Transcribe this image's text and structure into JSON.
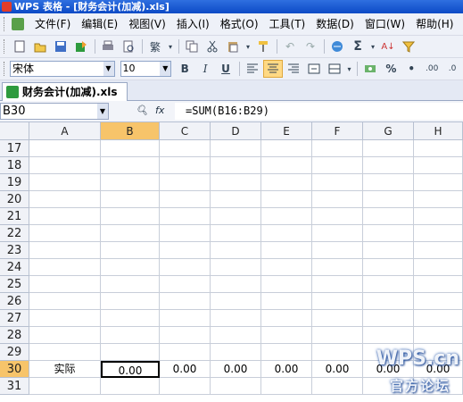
{
  "window": {
    "title": "WPS 表格 - [财务会计(加减).xls]"
  },
  "menu": {
    "items": [
      "文件(F)",
      "编辑(E)",
      "视图(V)",
      "插入(I)",
      "格式(O)",
      "工具(T)",
      "数据(D)",
      "窗口(W)",
      "帮助(H)"
    ]
  },
  "toolbar": {
    "icons": [
      "new-icon",
      "open-icon",
      "save-icon",
      "save-as-icon",
      "print-icon",
      "print-preview-icon",
      "traditional-chinese-icon",
      "copy-icon",
      "cut-icon",
      "paste-icon",
      "format-painter-icon",
      "undo-icon",
      "redo-icon",
      "hyperlink-icon",
      "sum-icon",
      "sort-asc-icon",
      "filter-icon"
    ],
    "traditional_label": "繁",
    "sum_label": "Σ"
  },
  "format_toolbar": {
    "font": "宋体",
    "size": "10",
    "bold": "B",
    "italic": "I",
    "underline": "U",
    "percent": "%",
    "comma": "•",
    "inc_decimal": ".00",
    "dec_decimal": ".0"
  },
  "document_tab": {
    "label": "财务会计(加减).xls"
  },
  "formula_bar": {
    "cell_ref": "B30",
    "formula": "=SUM(B16:B29)"
  },
  "sheet": {
    "columns": [
      "A",
      "B",
      "C",
      "D",
      "E",
      "F",
      "G",
      "H"
    ],
    "active_column": "B",
    "rows": [
      "17",
      "18",
      "19",
      "20",
      "21",
      "22",
      "23",
      "24",
      "25",
      "26",
      "27",
      "28",
      "29",
      "30",
      "31"
    ],
    "active_row": "30",
    "row30_cells": [
      "实际",
      "0.00",
      "0.00",
      "0.00",
      "0.00",
      "0.00",
      "0.00",
      "0.00"
    ]
  },
  "watermark": {
    "logo": "WPS.cn",
    "sub": "官方论坛"
  }
}
